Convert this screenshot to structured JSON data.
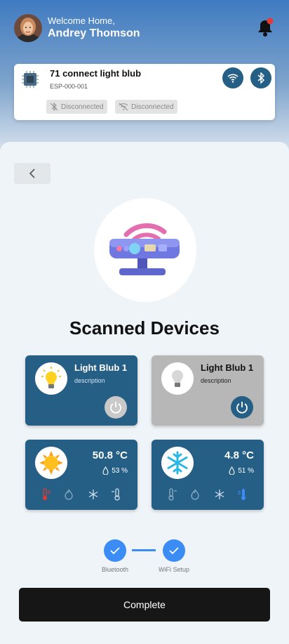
{
  "header": {
    "welcome": "Welcome Home,",
    "user_name": "Andrey Thomson",
    "notification_badge_color": "#e53935"
  },
  "device": {
    "title": "71 connect light blub",
    "id": "ESP-000-001",
    "bluetooth_status": "Disconnected",
    "wifi_status": "Disconnected"
  },
  "main": {
    "title": "Scanned Devices",
    "tiles": [
      {
        "name": "Light Blub 1",
        "description": "description",
        "state": "on",
        "icon": "bulb-icon"
      },
      {
        "name": "Light Blub 1",
        "description": "description",
        "state": "off",
        "icon": "bulb-icon"
      },
      {
        "temperature": "50.8 °C",
        "humidity": "53 %",
        "icon": "sun-icon",
        "active_mode": "heat"
      },
      {
        "temperature": "4.8 °C",
        "humidity": "51 %",
        "icon": "snowflake-icon",
        "active_mode": "cool"
      }
    ],
    "steps": [
      {
        "label": "Bluetooth",
        "done": true
      },
      {
        "label": "WiFi Setup",
        "done": true
      }
    ],
    "complete_label": "Complete"
  },
  "colors": {
    "primary": "#255f86",
    "accent_blue": "#3b8cf4",
    "heat_red": "#e53935",
    "button_dark": "#161616"
  }
}
